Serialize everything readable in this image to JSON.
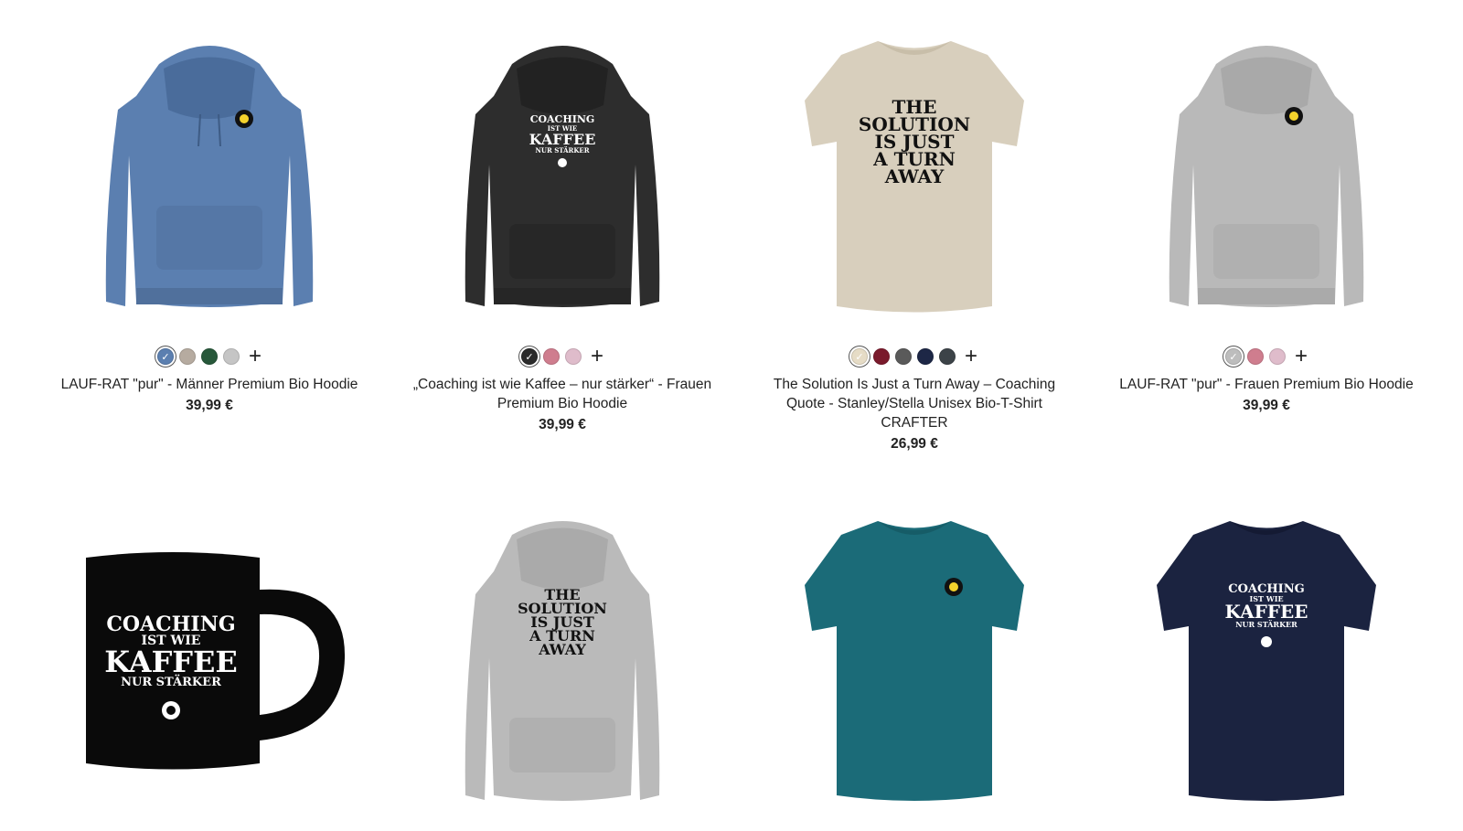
{
  "products": [
    {
      "title": "LAUF-RAT \"pur\" - Männer Premium Bio Hoodie",
      "price": "39,99 €",
      "image": "blue-hoodie-with-gear-logo",
      "color": "#5b7fb0",
      "swatches": [
        "#5b7fb0",
        "#b6aba0",
        "#27583a",
        "#c5c5c5"
      ]
    },
    {
      "title": "„Coaching ist wie Kaffee – nur stärker“ - Frauen Premium Bio Hoodie",
      "price": "39,99 €",
      "image": "black-hoodie-coaching-kaffee-print",
      "color": "#2d2d2d",
      "print": [
        "COACHING",
        "IST WIE",
        "KAFFEE",
        "NUR STÄRKER"
      ],
      "swatches": [
        "#2b2b2b",
        "#cf7d8e",
        "#dfbccb"
      ]
    },
    {
      "title": "The Solution Is Just a Turn Away – Coaching Quote - Stanley/Stella Unisex Bio-T-Shirt CRAFTER",
      "price": "26,99 €",
      "image": "beige-tshirt-solution-print",
      "color": "#d8cfbd",
      "print": [
        "THE",
        "SOLUTION",
        "IS JUST",
        "A TURN",
        "AWAY"
      ],
      "swatches": [
        "#e6dcc6",
        "#7a1a2c",
        "#5a5a5a",
        "#1d2746",
        "#3c4348"
      ]
    },
    {
      "title": "LAUF-RAT \"pur\" - Frauen Premium Bio Hoodie",
      "price": "39,99 €",
      "image": "grey-hoodie-with-gear-logo",
      "color": "#b9b9b9",
      "swatches": [
        "#bdbdbd",
        "#cf7d8e",
        "#dfbccb"
      ]
    },
    {
      "image": "black-mug-coaching-kaffee-print",
      "color": "#0a0a0a",
      "print": [
        "COACHING",
        "IST WIE",
        "KAFFEE",
        "NUR STÄRKER"
      ]
    },
    {
      "image": "grey-hoodie-solution-print",
      "color": "#bababa",
      "print": [
        "THE",
        "SOLUTION",
        "IS JUST",
        "A TURN",
        "AWAY"
      ]
    },
    {
      "image": "teal-tshirt-with-gear-logo",
      "color": "#1b6b78"
    },
    {
      "image": "navy-tshirt-coaching-kaffee-print",
      "color": "#1b2340",
      "print": [
        "COACHING",
        "IST WIE",
        "KAFFEE",
        "NUR STÄRKER"
      ]
    }
  ]
}
